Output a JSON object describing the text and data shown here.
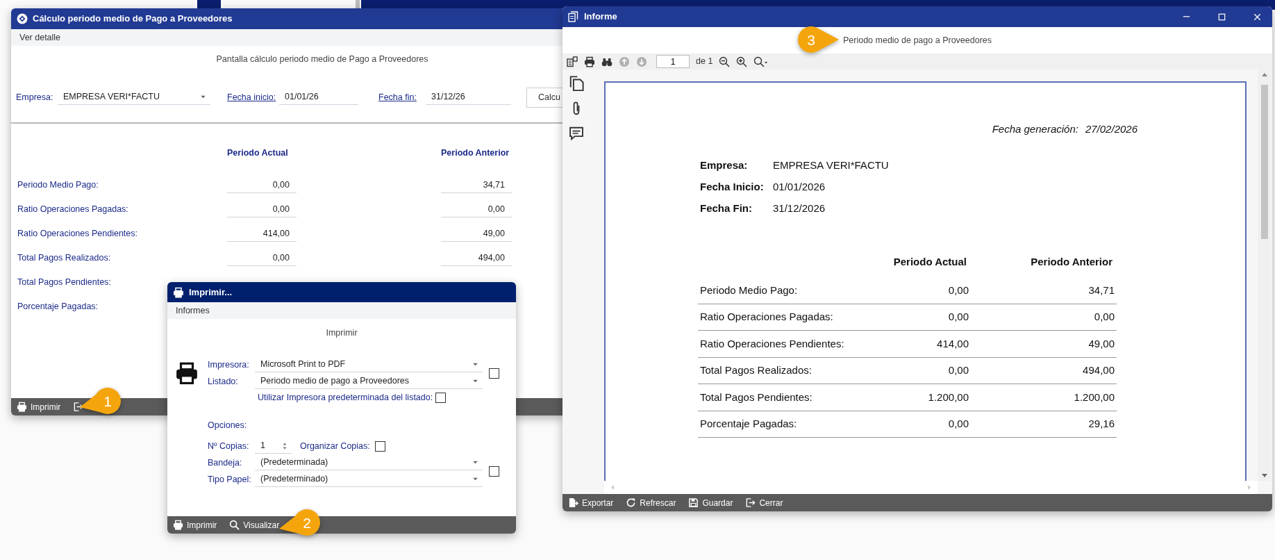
{
  "main_window": {
    "title": "Cálculo periodo medio de Pago a Proveedores",
    "menu": [
      {
        "label": "Ver detalle"
      }
    ],
    "heading": "Pantalla cálculo periodo medio de Pago a Proveedores",
    "filters": [
      {
        "label": "Empresa:",
        "value": "EMPRESA VERI*FACTU",
        "kind": "select",
        "link": false
      },
      {
        "label": "Fecha inicio:",
        "value": "01/01/26",
        "kind": "date",
        "link": true
      },
      {
        "label": "Fecha fin:",
        "value": "31/12/26",
        "kind": "date",
        "link": true
      }
    ],
    "action_button": "Calcu",
    "columns": [
      "Periodo Actual",
      "Periodo Anterior"
    ],
    "rows": [
      {
        "label": "Periodo Medio Pago:",
        "values": [
          "0,00",
          "34,71"
        ]
      },
      {
        "label": "Ratio Operaciones Pagadas:",
        "values": [
          "0,00",
          "0,00"
        ]
      },
      {
        "label": "Ratio Operaciones Pendientes:",
        "values": [
          "414,00",
          "49,00"
        ]
      },
      {
        "label": "Total Pagos Realizados:",
        "values": [
          "0,00",
          "494,00"
        ]
      },
      {
        "label": "Total Pagos Pendientes:"
      },
      {
        "label": "Porcentaje Pagadas:"
      }
    ],
    "footer": [
      {
        "kind": "print",
        "label": "Imprimir"
      },
      {
        "kind": "exit"
      }
    ]
  },
  "print_dialog": {
    "title": "Imprimir...",
    "menu": [
      {
        "label": "Informes"
      }
    ],
    "heading": "Imprimir",
    "selects": [
      {
        "label": "Impresora:",
        "value": "Microsoft Print to PDF"
      },
      {
        "label": "Listado:",
        "value": "Periodo medio de pago a Proveedores"
      }
    ],
    "printer_checkbox": {
      "checked": false
    },
    "default_printer": {
      "label": "Utilizar Impresora predeterminada del listado:",
      "checked": false
    },
    "options_label": "Opciones:",
    "copies": {
      "label": "Nº Copias:",
      "value": "1"
    },
    "collate": {
      "label": "Organizar Copias:",
      "checked": false
    },
    "paper_selects": [
      {
        "label": "Bandeja:",
        "value": "(Predeterminada)"
      },
      {
        "label": "Tipo Papel:",
        "value": "(Predeterminado)"
      }
    ],
    "paper_checkbox": {
      "checked": false
    },
    "footer": [
      {
        "kind": "print",
        "label": "Imprimir"
      },
      {
        "kind": "search",
        "label": "Visualizar"
      }
    ]
  },
  "report_window": {
    "title": "Informe",
    "report_title": "Periodo medio de pago a Proveedores",
    "tools": [
      {
        "kind": "map",
        "disabled": false
      },
      {
        "kind": "print",
        "disabled": false
      },
      {
        "kind": "find",
        "disabled": false
      },
      {
        "kind": "prev",
        "disabled": true
      },
      {
        "kind": "next",
        "disabled": true
      }
    ],
    "page": {
      "value": "1"
    },
    "page_count": "de 1",
    "zoom_tools": [
      {
        "kind": "zoom_out",
        "disabled": false
      },
      {
        "kind": "zoom_in",
        "disabled": false
      },
      {
        "kind": "zoom_menu",
        "disabled": false
      }
    ],
    "side_tools": [
      {
        "kind": "pages"
      },
      {
        "kind": "attach"
      },
      {
        "kind": "comment"
      }
    ],
    "document": {
      "generated_label": "Fecha generación:",
      "generated_value": "27/02/2026",
      "info": [
        {
          "label": "Empresa:",
          "value": "EMPRESA VERI*FACTU"
        },
        {
          "label": "Fecha Inicio:",
          "value": "01/01/2026"
        },
        {
          "label": "Fecha Fin:",
          "value": "31/12/2026"
        }
      ],
      "columns": [
        "Periodo Actual",
        "Periodo Anterior"
      ],
      "rows": [
        {
          "label": "Periodo Medio Pago:",
          "values": [
            "0,00",
            "34,71"
          ]
        },
        {
          "label": "Ratio Operaciones Pagadas:",
          "values": [
            "0,00",
            "0,00"
          ]
        },
        {
          "label": "Ratio Operaciones Pendientes:",
          "values": [
            "414,00",
            "49,00"
          ]
        },
        {
          "label": "Total Pagos Realizados:",
          "values": [
            "0,00",
            "494,00"
          ]
        },
        {
          "label": "Total Pagos Pendientes:",
          "values": [
            "1.200,00",
            "1.200,00"
          ]
        },
        {
          "label": "Porcentaje Pagadas:",
          "values": [
            "0,00",
            "29,16"
          ]
        }
      ]
    },
    "footer": [
      {
        "kind": "export",
        "label": "Exportar"
      },
      {
        "kind": "refresh",
        "label": "Refrescar"
      },
      {
        "kind": "save",
        "label": "Guardar"
      },
      {
        "kind": "exit",
        "label": "Cerrar"
      }
    ]
  },
  "callouts": [
    {
      "number": "1"
    },
    {
      "number": "2"
    },
    {
      "number": "3"
    }
  ]
}
